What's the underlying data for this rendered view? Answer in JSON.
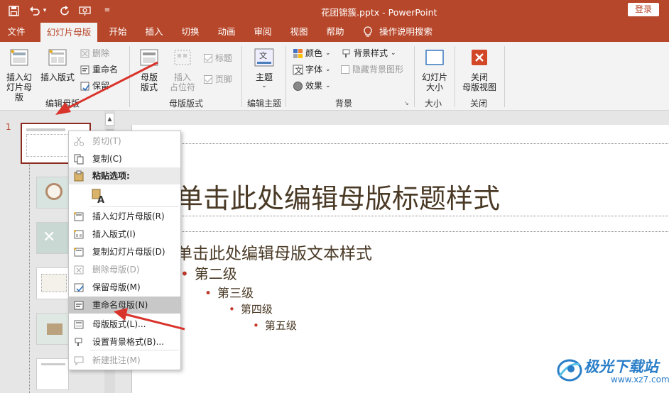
{
  "window": {
    "doc_title": "花团锦簇.pptx  -  PowerPoint",
    "login": "登录"
  },
  "tabs": [
    {
      "label": "文件"
    },
    {
      "label": "幻灯片母版",
      "active": true
    },
    {
      "label": "开始"
    },
    {
      "label": "插入"
    },
    {
      "label": "切换"
    },
    {
      "label": "动画"
    },
    {
      "label": "审阅"
    },
    {
      "label": "视图"
    },
    {
      "label": "帮助"
    },
    {
      "label": "操作说明搜索"
    }
  ],
  "ribbon": {
    "edit_master": {
      "insert_slide_master": "插入幻\n灯片母版",
      "insert_layout": "插入版式",
      "delete": "删除",
      "rename": "重命名",
      "preserve": "保留",
      "label": "编辑母版"
    },
    "master_layout": {
      "master_layout_btn": "母版\n版式",
      "insert_placeholder": "插入\n占位符",
      "title_cb": "标题",
      "footer_cb": "页脚",
      "label": "母版版式"
    },
    "edit_theme": {
      "themes": "主题",
      "label": "编辑主题"
    },
    "background": {
      "colors": "颜色",
      "fonts": "字体",
      "effects": "效果",
      "bg_styles": "背景样式",
      "hide_bg": "隐藏背景图形",
      "label": "背景"
    },
    "size": {
      "slide_size": "幻灯片\n大小",
      "label": "大小"
    },
    "close": {
      "close_master": "关闭\n母版视图",
      "label": "关闭"
    }
  },
  "thumbs": {
    "number": "1"
  },
  "slide": {
    "title": "单击此处编辑母版标题样式",
    "body": "单击此处编辑母版文本样式",
    "level2": "第二级",
    "level3": "第三级",
    "level4": "第四级",
    "level5": "第五级"
  },
  "context_menu": {
    "cut": "剪切(T)",
    "copy": "复制(C)",
    "paste_options": "粘贴选项:",
    "insert_slide_master": "插入幻灯片母版(R)",
    "insert_layout": "插入版式(I)",
    "duplicate_master": "复制幻灯片母版(D)",
    "delete_master": "删除母版(D)",
    "preserve_master": "保留母版(M)",
    "rename_master": "重命名母版(N)",
    "master_layout": "母版版式(L)...",
    "format_background": "设置背景格式(B)...",
    "new_comment": "新建批注(M)"
  },
  "watermark": {
    "name": "极光下载站",
    "url": "www.xz7.com"
  },
  "colors": {
    "accent": "#b7472a",
    "arrow": "#d9342b"
  }
}
